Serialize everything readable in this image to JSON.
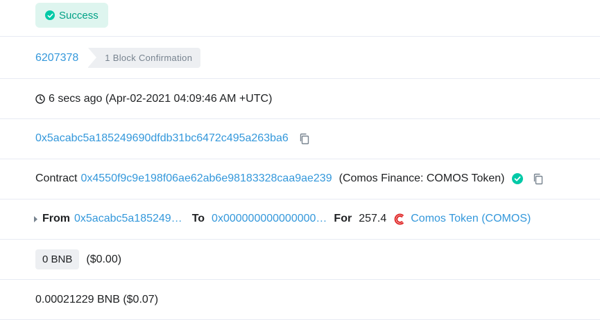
{
  "status": {
    "label": "Success",
    "color": "#00a186"
  },
  "block": {
    "number": "6207378",
    "confirmation": "1 Block Confirmation"
  },
  "timestamp": {
    "text": "6 secs ago (Apr-02-2021 04:09:46 AM +UTC)",
    "icon": "clock-icon"
  },
  "from_address": "0x5acabc5a185249690dfdb31bc6472c495a263ba6",
  "interacted": {
    "prefix": "Contract",
    "address": "0x4550f9c9e198f06ae62ab6e98183328caa9ae239",
    "name": "(Comos Finance: COMOS Token)"
  },
  "transfer": {
    "from_label": "From",
    "from_value": "0x5acabc5a185249…",
    "to_label": "To",
    "to_value": "0x000000000000000…",
    "for_label": "For",
    "amount": "257.4",
    "token": "Comos Token (COMOS)",
    "token_icon_color": "#e02a2a"
  },
  "value": {
    "amount": "0 BNB",
    "usd": "($0.00)"
  },
  "fee": {
    "text": "0.00021229 BNB ($0.07)"
  },
  "colors": {
    "link": "#3498db",
    "border": "#e7eaf3",
    "badge_bg": "#edeff2"
  }
}
